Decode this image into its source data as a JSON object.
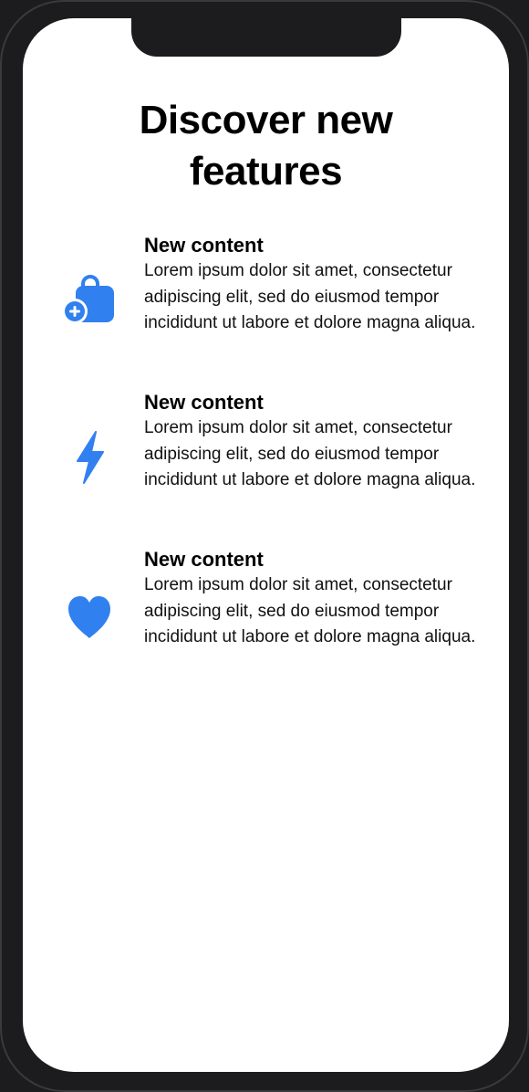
{
  "page": {
    "title_line1": "Discover new",
    "title_line2": "features"
  },
  "features": [
    {
      "icon": "bag-badge-plus-icon",
      "title": "New content",
      "body": "Lorem ipsum dolor sit amet, consectetur adipiscing elit, sed do eiusmod tempor incididunt ut labore et dolore magna aliqua."
    },
    {
      "icon": "bolt-icon",
      "title": "New content",
      "body": "Lorem ipsum dolor sit amet, consectetur adipiscing elit, sed do eiusmod tempor incididunt ut labore et dolore magna aliqua."
    },
    {
      "icon": "heart-icon",
      "title": "New content",
      "body": "Lorem ipsum dolor sit amet, consectetur adipiscing elit, sed do eiusmod tempor incididunt ut labore et dolore magna aliqua."
    }
  ],
  "colors": {
    "accent": "#3180f0",
    "background": "#ffffff",
    "device": "#1c1c1e"
  }
}
